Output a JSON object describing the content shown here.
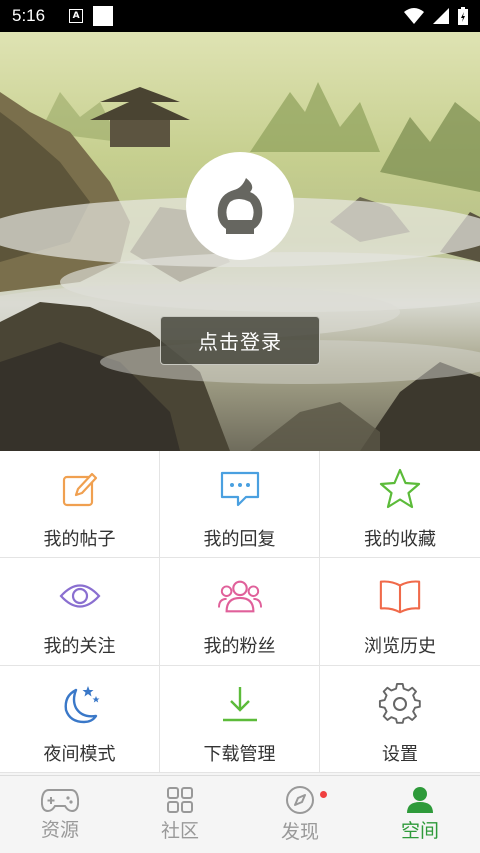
{
  "status_bar": {
    "time": "5:16",
    "notif_icon_a": "A"
  },
  "hero": {
    "login_label": "点击登录"
  },
  "menu": [
    {
      "label": "我的帖子",
      "icon": "edit-icon",
      "color": "#f0a050"
    },
    {
      "label": "我的回复",
      "icon": "chat-bubble-icon",
      "color": "#4aa0e0"
    },
    {
      "label": "我的收藏",
      "icon": "star-icon",
      "color": "#5cbb3a"
    },
    {
      "label": "我的关注",
      "icon": "eye-icon",
      "color": "#8a6fd0"
    },
    {
      "label": "我的粉丝",
      "icon": "users-icon",
      "color": "#e0609a"
    },
    {
      "label": "浏览历史",
      "icon": "book-icon",
      "color": "#f06a4a"
    },
    {
      "label": "夜间模式",
      "icon": "moon-stars-icon",
      "color": "#3a78c8"
    },
    {
      "label": "下载管理",
      "icon": "download-icon",
      "color": "#5cbb3a"
    },
    {
      "label": "设置",
      "icon": "gear-icon",
      "color": "#666666"
    }
  ],
  "bottom_nav": [
    {
      "label": "资源",
      "icon": "gamepad-icon",
      "active": false
    },
    {
      "label": "社区",
      "icon": "grid-icon",
      "active": false
    },
    {
      "label": "发现",
      "icon": "compass-icon",
      "active": false,
      "badge": true
    },
    {
      "label": "空间",
      "icon": "person-icon",
      "active": true
    }
  ],
  "colors": {
    "active": "#2e9a3a",
    "inactive": "#999999",
    "badge": "#f04040"
  }
}
